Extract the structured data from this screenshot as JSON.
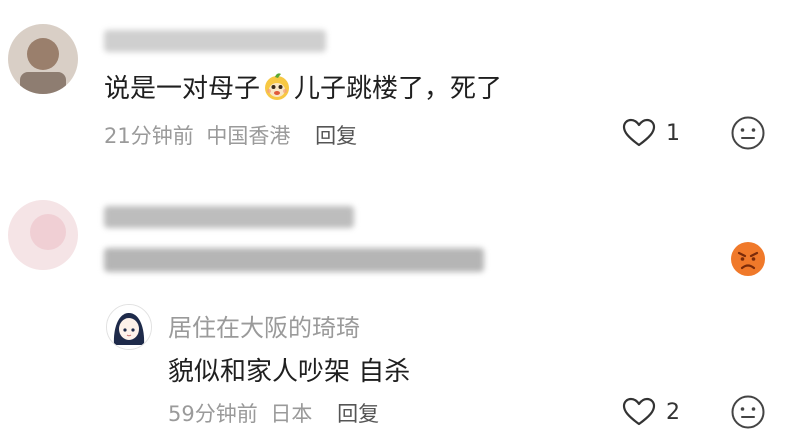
{
  "comments": [
    {
      "content_pre": "说是一对母子",
      "content_post": "儿子跳楼了，死了",
      "inline_emoji": "orange-cartoon-emoji",
      "time": "21分钟前",
      "location": "中国香港",
      "reply_label": "回复",
      "like_count": "1"
    },
    {
      "reaction_emoji": "angry-face-emoji"
    }
  ],
  "reply": {
    "username": "居住在大阪的琦琦",
    "content": "貌似和家人吵架 自杀",
    "time": "59分钟前",
    "location": "日本",
    "reply_label": "回复",
    "like_count": "2"
  },
  "colors": {
    "meta_gray": "#9a9a9a",
    "reaction_orange": "#f0792a"
  }
}
